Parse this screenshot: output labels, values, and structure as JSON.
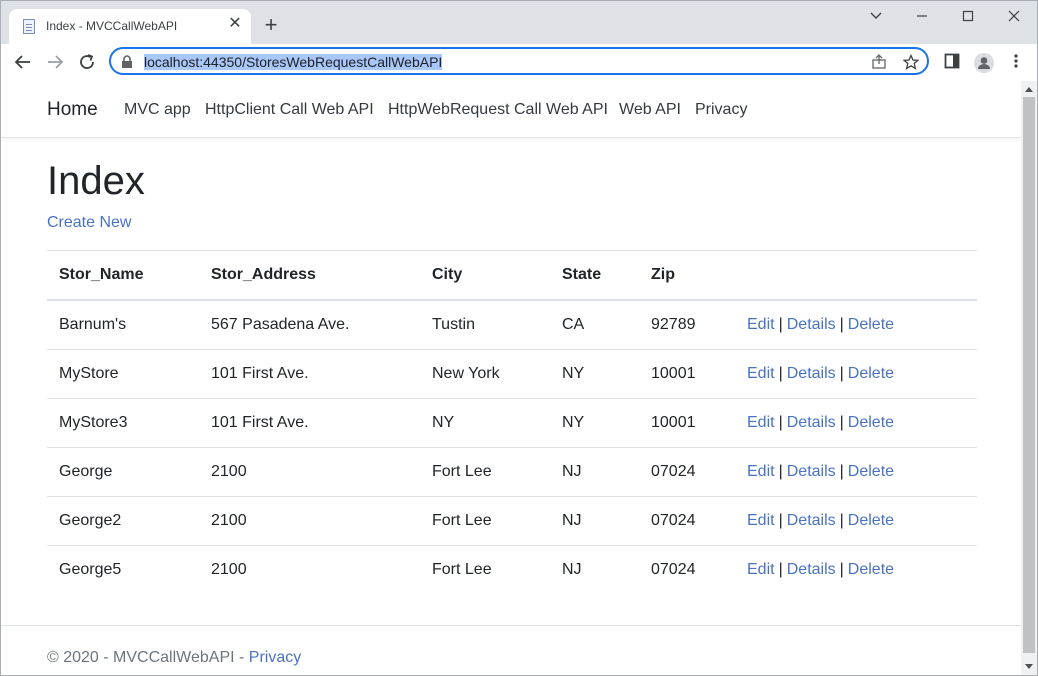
{
  "browser": {
    "tab_title": "Index - MVCCallWebAPI",
    "url": "localhost:44350/StoresWebRequestCallWebAPI"
  },
  "navbar": {
    "brand": "Home",
    "links": [
      "MVC app",
      "HttpClient Call Web API",
      "HttpWebRequest Call Web API",
      "Web API",
      "Privacy"
    ]
  },
  "main": {
    "title": "Index",
    "create_link": "Create New",
    "table": {
      "headers": [
        "Stor_Name",
        "Stor_Address",
        "City",
        "State",
        "Zip"
      ],
      "rows": [
        [
          "Barnum's",
          "567 Pasadena Ave.",
          "Tustin",
          "CA",
          "92789"
        ],
        [
          "MyStore",
          "101 First Ave.",
          "New York",
          "NY",
          "10001"
        ],
        [
          "MyStore3",
          "101 First Ave.",
          "NY",
          "NY",
          "10001"
        ],
        [
          "George",
          "2100",
          "Fort Lee",
          "NJ",
          "07024"
        ],
        [
          "George2",
          "2100",
          "Fort Lee",
          "NJ",
          "07024"
        ],
        [
          "George5",
          "2100",
          "Fort Lee",
          "NJ",
          "07024"
        ]
      ],
      "actions": {
        "edit": "Edit",
        "details": "Details",
        "delete": "Delete",
        "separator": "|"
      }
    }
  },
  "footer": {
    "text": "© 2020 - MVCCallWebAPI - ",
    "privacy": "Privacy"
  },
  "colors": {
    "link": "#4a72c4",
    "accent": "#1a73e8"
  }
}
